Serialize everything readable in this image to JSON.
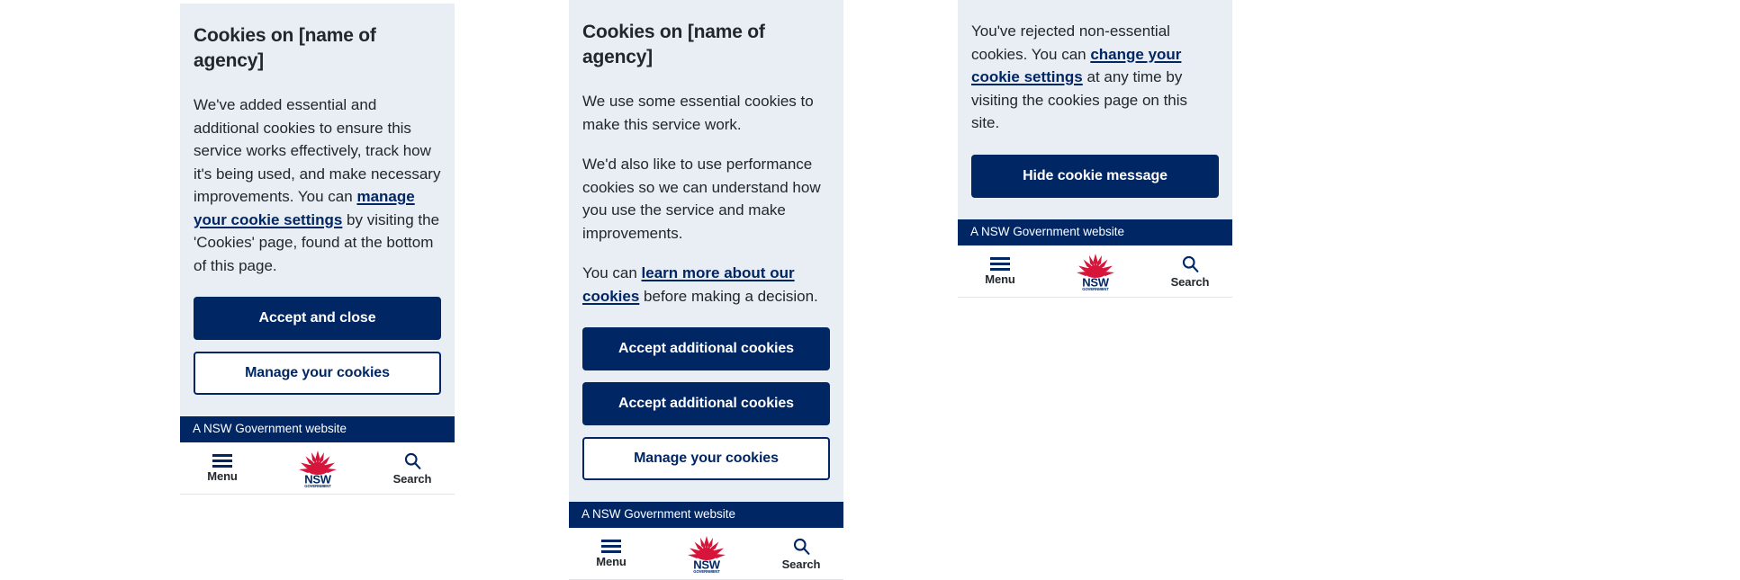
{
  "page": {
    "background": "#ffffff",
    "accent_navy": "#002664",
    "panel_background": "#e9edf4",
    "text_color": "#22272b",
    "logo_red": "#d7153a"
  },
  "cards": [
    {
      "id": "cookie-banner-accepted",
      "title": "Cookies on [name of agency]",
      "paragraphs": [
        {
          "segments": [
            {
              "type": "text",
              "text": "We've added essential and additional cookies to ensure this service works effectively, track how it's being used, and make necessary improvements. You can "
            },
            {
              "type": "link",
              "text": "manage your cookie settings"
            },
            {
              "type": "text",
              "text": " by visiting the 'Cookies' page, found at the bottom of this page."
            }
          ]
        }
      ],
      "buttons": [
        {
          "label": "Accept and close",
          "style": "primary"
        },
        {
          "label": "Manage your cookies",
          "style": "secondary"
        }
      ],
      "gov_strip": "A NSW Government website",
      "nav": {
        "menu_label": "Menu",
        "menu_icon": "hamburger-icon",
        "logo": {
          "name": "nsw-government-logo",
          "primary_text": "NSW",
          "secondary_text": "GOVERNMENT"
        },
        "search_label": "Search",
        "search_icon": "search-icon"
      }
    },
    {
      "id": "cookie-banner-choice",
      "title": "Cookies on [name of agency]",
      "paragraphs": [
        {
          "segments": [
            {
              "type": "text",
              "text": "We use some essential cookies to make this service work."
            }
          ]
        },
        {
          "segments": [
            {
              "type": "text",
              "text": "We'd also like to use performance cookies so we can understand how you use the service and make improvements."
            }
          ]
        },
        {
          "segments": [
            {
              "type": "text",
              "text": "You can "
            },
            {
              "type": "link",
              "text": "learn more about our cookies"
            },
            {
              "type": "text",
              "text": " before making a decision."
            }
          ]
        }
      ],
      "buttons": [
        {
          "label": "Accept additional cookies",
          "style": "primary"
        },
        {
          "label": "Accept additional cookies",
          "style": "primary"
        },
        {
          "label": "Manage your cookies",
          "style": "secondary"
        }
      ],
      "gov_strip": "A NSW Government website",
      "nav": {
        "menu_label": "Menu",
        "menu_icon": "hamburger-icon",
        "logo": {
          "name": "nsw-government-logo",
          "primary_text": "NSW",
          "secondary_text": "GOVERNMENT"
        },
        "search_label": "Search",
        "search_icon": "search-icon"
      }
    },
    {
      "id": "cookie-banner-rejected",
      "title": "",
      "paragraphs": [
        {
          "segments": [
            {
              "type": "text",
              "text": "You've rejected non-essential cookies. You can "
            },
            {
              "type": "link",
              "text": "change your cookie settings"
            },
            {
              "type": "text",
              "text": " at any time by visiting the cookies page on this site."
            }
          ]
        }
      ],
      "buttons": [
        {
          "label": "Hide cookie message",
          "style": "primary"
        }
      ],
      "gov_strip": "A NSW Government website",
      "nav": {
        "menu_label": "Menu",
        "menu_icon": "hamburger-icon",
        "logo": {
          "name": "nsw-government-logo",
          "primary_text": "NSW",
          "secondary_text": "GOVERNMENT"
        },
        "search_label": "Search",
        "search_icon": "search-icon"
      }
    }
  ]
}
